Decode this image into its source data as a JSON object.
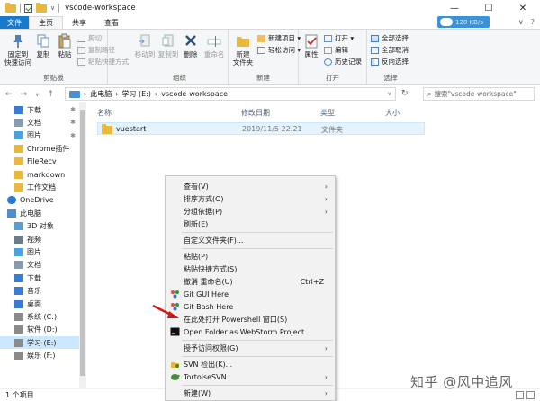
{
  "window": {
    "title": "vscode-workspace",
    "controls": {
      "minimize": "—",
      "maximize": "☐",
      "close": "✕"
    }
  },
  "tabs": [
    {
      "label": "文件"
    },
    {
      "label": "主页"
    },
    {
      "label": "共享"
    },
    {
      "label": "查看"
    }
  ],
  "cloud_speed": "128 KB/s",
  "ribbon": {
    "clipboard": {
      "group_label": "剪贴板",
      "pin_label": "固定到\n快速访问",
      "copy_label": "复制",
      "paste_label": "粘贴",
      "cut_label": "剪切",
      "copy_path_label": "复制路径",
      "paste_shortcut_label": "粘贴快捷方式"
    },
    "organize": {
      "group_label": "组织",
      "move_to_label": "移动到",
      "copy_to_label": "复制到",
      "delete_label": "删除",
      "rename_label": "重命名"
    },
    "new": {
      "group_label": "新建",
      "new_folder_label": "新建\n文件夹",
      "new_item_label": "新建项目 ▾",
      "easy_access_label": "轻松访问 ▾"
    },
    "open": {
      "group_label": "打开",
      "properties_label": "属性",
      "open_label": "打开 ▾",
      "edit_label": "编辑",
      "history_label": "历史记录"
    },
    "select": {
      "group_label": "选择",
      "select_all_label": "全部选择",
      "select_none_label": "全部取消",
      "invert_label": "反向选择"
    }
  },
  "address": {
    "breadcrumb": [
      "此电脑",
      "学习 (E:)",
      "vscode-workspace"
    ],
    "search_placeholder": "搜索\"vscode-workspace\""
  },
  "nav_items": [
    {
      "label": "下载",
      "icon": "download-icon",
      "pinned": true
    },
    {
      "label": "文档",
      "icon": "document-icon",
      "pinned": true
    },
    {
      "label": "图片",
      "icon": "picture-icon",
      "pinned": true
    },
    {
      "label": "Chrome插件",
      "icon": "folder-icon",
      "pinned": false
    },
    {
      "label": "FileRecv",
      "icon": "folder-icon",
      "pinned": false
    },
    {
      "label": "markdown",
      "icon": "folder-icon",
      "pinned": false
    },
    {
      "label": "工作文档",
      "icon": "folder-icon",
      "pinned": false
    },
    {
      "label": "OneDrive",
      "icon": "cloud-icon",
      "pinned": false
    },
    {
      "label": "此电脑",
      "icon": "computer-icon",
      "pinned": false
    },
    {
      "label": "3D 对象",
      "icon": "3d-objects-icon",
      "pinned": false
    },
    {
      "label": "视频",
      "icon": "video-icon",
      "pinned": false
    },
    {
      "label": "图片",
      "icon": "picture-icon",
      "pinned": false
    },
    {
      "label": "文档",
      "icon": "document-icon",
      "pinned": false
    },
    {
      "label": "下载",
      "icon": "download-icon",
      "pinned": false
    },
    {
      "label": "音乐",
      "icon": "music-icon",
      "pinned": false
    },
    {
      "label": "桌面",
      "icon": "desktop-icon",
      "pinned": false
    },
    {
      "label": "系统 (C:)",
      "icon": "drive-icon",
      "pinned": false
    },
    {
      "label": "软件 (D:)",
      "icon": "drive-icon",
      "pinned": false
    },
    {
      "label": "学习 (E:)",
      "icon": "drive-icon",
      "pinned": false,
      "selected": true
    },
    {
      "label": "娱乐 (F:)",
      "icon": "drive-icon",
      "pinned": false
    }
  ],
  "columns": {
    "name": "名称",
    "date": "修改日期",
    "type": "类型",
    "size": "大小"
  },
  "files": [
    {
      "name": "vuestart",
      "date": "2019/11/5 22:21",
      "type": "文件夹",
      "size": ""
    }
  ],
  "status": "1 个项目",
  "context_menu": {
    "view": "查看(V)",
    "sort": "排序方式(O)",
    "group": "分组依据(P)",
    "refresh": "刷新(E)",
    "customize": "自定义文件夹(F)...",
    "paste": "粘贴(P)",
    "paste_shortcut": "粘贴快捷方式(S)",
    "undo_rename": "撤消 重命名(U)",
    "undo_shortcut": "Ctrl+Z",
    "git_gui": "Git GUI Here",
    "git_bash": "Git Bash Here",
    "powershell": "在此处打开 Powershell 窗口(S)",
    "webstorm": "Open Folder as WebStorm Project",
    "access": "授予访问权限(G)",
    "svn_checkout": "SVN 检出(K)...",
    "tortoise": "TortoiseSVN",
    "new": "新建(W)"
  },
  "watermark": "知乎 @风中追风"
}
